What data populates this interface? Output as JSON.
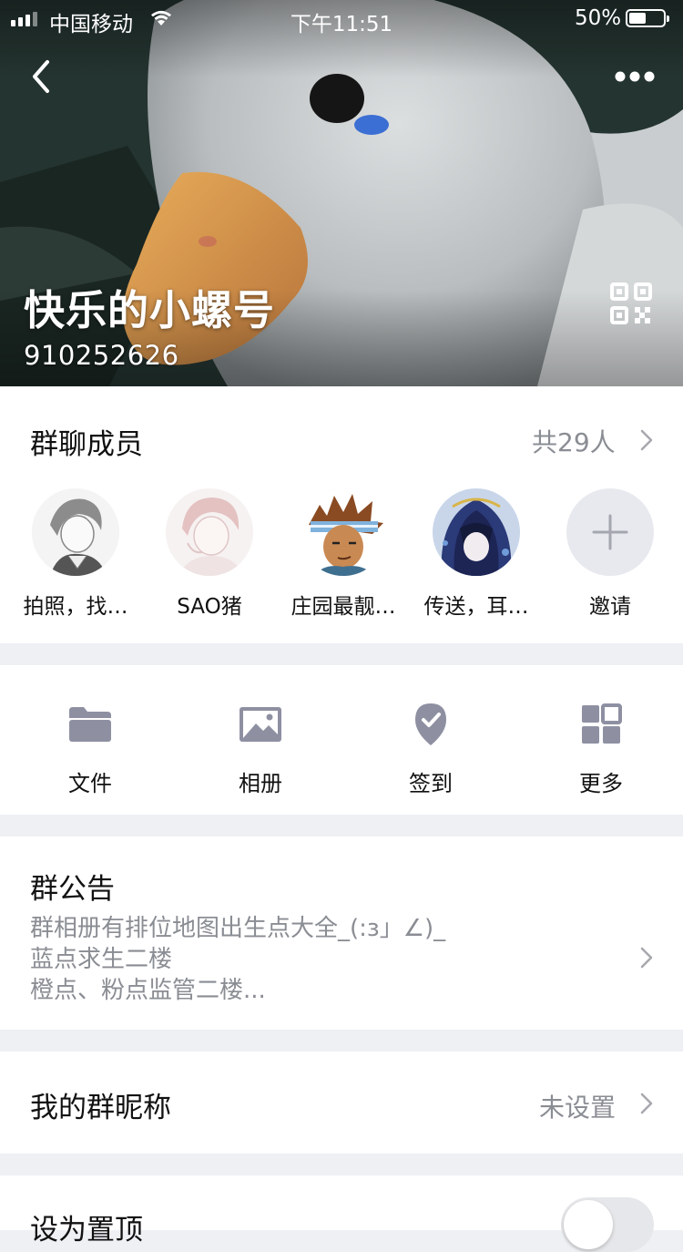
{
  "status_bar": {
    "carrier": "中国移动",
    "time": "下午11:51",
    "battery_percent": "50%",
    "battery_level": 0.5
  },
  "header": {
    "group_name": "快乐的小螺号",
    "group_number": "910252626",
    "back_icon": "chevron-left-icon",
    "more_icon": "ellipsis-icon",
    "qr_icon": "qr-code-icon"
  },
  "members": {
    "title": "群聊成员",
    "count_label": "共29人",
    "list": [
      {
        "name": "拍照，找…"
      },
      {
        "name": "SAO猪"
      },
      {
        "name": "庄园最靓…"
      },
      {
        "name": "传送，耳…"
      }
    ],
    "invite_label": "邀请"
  },
  "tools": [
    {
      "label": "文件",
      "icon": "folder-icon"
    },
    {
      "label": "相册",
      "icon": "image-icon"
    },
    {
      "label": "签到",
      "icon": "checkin-pin-icon"
    },
    {
      "label": "更多",
      "icon": "grid-icon"
    }
  ],
  "notice": {
    "title": "群公告",
    "lines": [
      "群相册有排位地图出生点大全_(:з」∠)_",
      "蓝点求生二楼",
      "橙点、粉点监管二楼..."
    ]
  },
  "nickname": {
    "title": "我的群昵称",
    "value": "未设置"
  },
  "pin": {
    "title": "设为置顶",
    "enabled": false
  },
  "colors": {
    "icon_gray": "#8e90a2",
    "separator": "#eef0f4",
    "secondary_text": "#8a8d93"
  }
}
